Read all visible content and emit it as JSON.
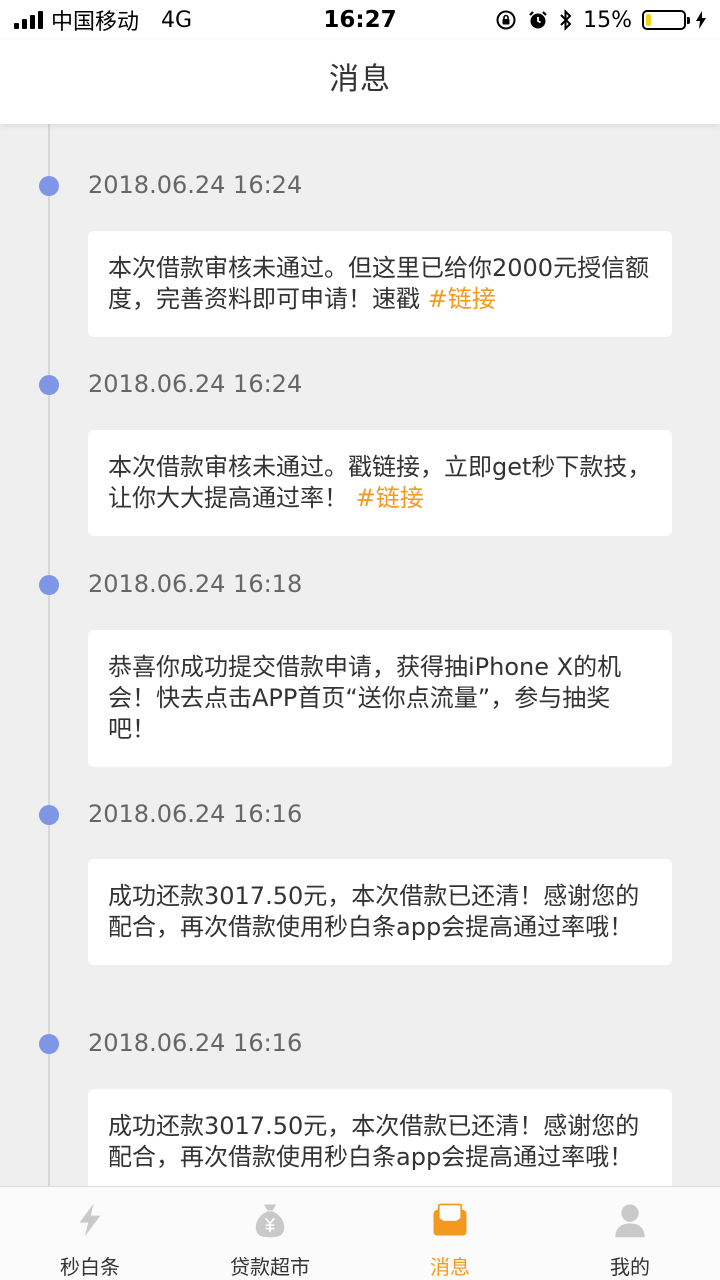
{
  "status_bar": {
    "carrier": "中国移动",
    "network": "4G",
    "time": "16:27",
    "battery": "15%",
    "battery_level": 0.15
  },
  "header": {
    "title": "消息"
  },
  "messages": [
    {
      "time": "2018.06.24 16:24",
      "text": "本次借款审核未通过。但这里已给你2000元授信额度，完善资料即可申请！速戳 ",
      "link": "#链接"
    },
    {
      "time": "2018.06.24 16:24",
      "text": "本次借款审核未通过。戳链接，立即get秒下款技，让你大大提高通过率！ ",
      "link": "#链接"
    },
    {
      "time": "2018.06.24 16:18",
      "text": "恭喜你成功提交借款申请，获得抽iPhone X的机会！快去点击APP首页“送你点流量”，参与抽奖吧！",
      "link": ""
    },
    {
      "time": "2018.06.24 16:16",
      "text": "成功还款3017.50元，本次借款已还清！感谢您的配合，再次借款使用秒白条app会提高通过率哦！",
      "link": ""
    },
    {
      "time": "2018.06.24 16:16",
      "text": "成功还款3017.50元，本次借款已还清！感谢您的配合，再次借款使用秒白条app会提高通过率哦！",
      "link": ""
    }
  ],
  "tabs": [
    {
      "label": "秒白条",
      "icon": "lightning-icon",
      "active": false
    },
    {
      "label": "贷款超市",
      "icon": "money-bag-icon",
      "active": false
    },
    {
      "label": "消息",
      "icon": "envelope-icon",
      "active": true
    },
    {
      "label": "我的",
      "icon": "person-icon",
      "active": false
    }
  ],
  "colors": {
    "accent": "#f39a1e",
    "timeline_dot": "#7f96e6",
    "background": "#efeff0",
    "tab_icon_inactive": "#c9c9c9"
  }
}
